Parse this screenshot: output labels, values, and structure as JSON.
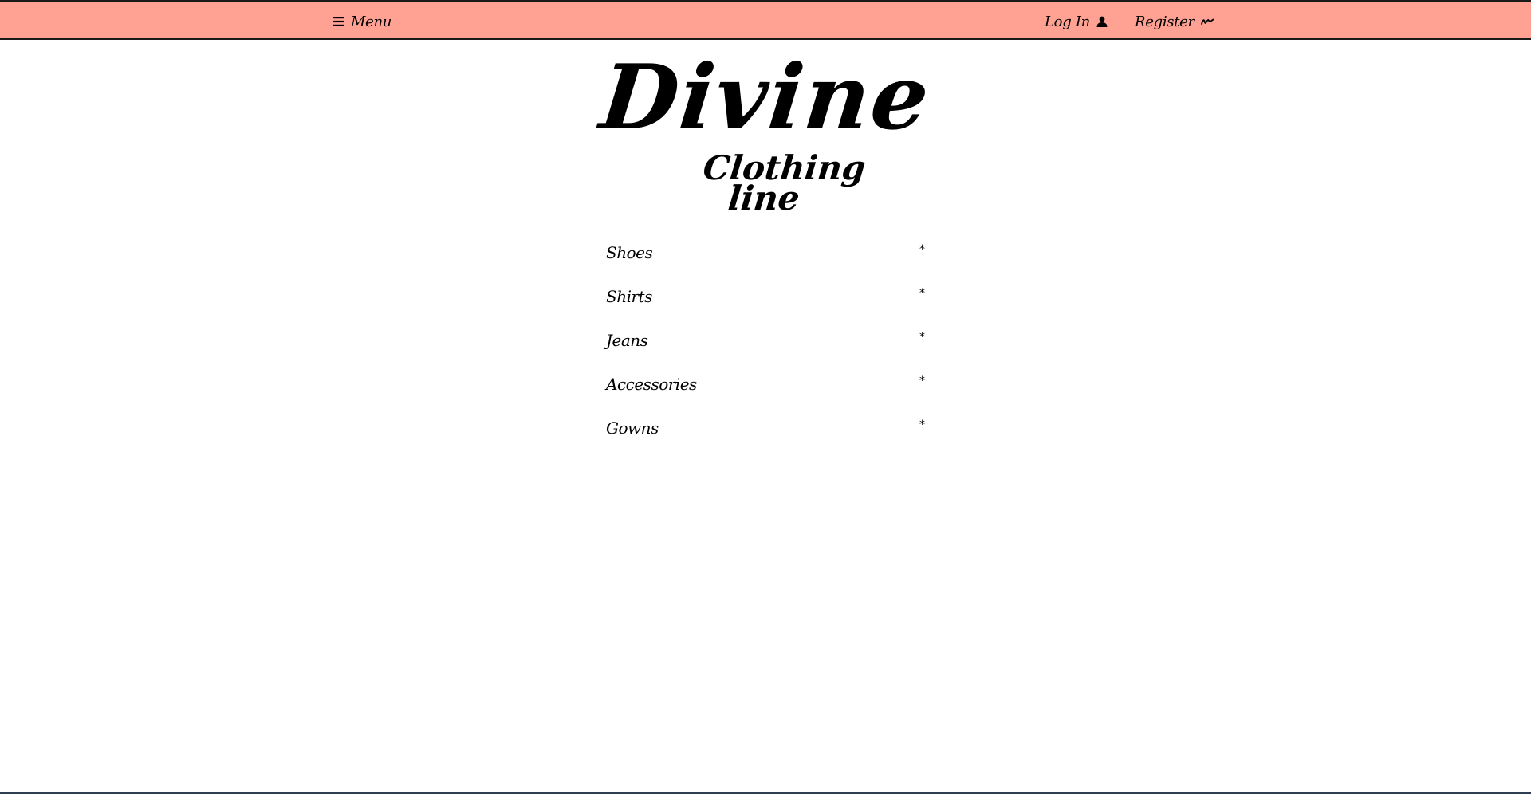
{
  "nav": {
    "menu_label": "Menu",
    "menu_icon": "hamburger-icon",
    "login_label": "Log In",
    "login_icon": "user-icon",
    "register_label": "Register",
    "register_icon": "signature-icon"
  },
  "brand": {
    "title": "Divine",
    "subtitle": "Clothing line"
  },
  "categories": [
    {
      "label": "Shoes",
      "mark": "*"
    },
    {
      "label": "Shirts",
      "mark": "*"
    },
    {
      "label": "Jeans",
      "mark": "*"
    },
    {
      "label": "Accessories",
      "mark": "*"
    },
    {
      "label": "Gowns",
      "mark": "*"
    }
  ],
  "colors": {
    "header_bg": "#ffa193",
    "text": "#000000",
    "page_bg": "#ffffff"
  }
}
